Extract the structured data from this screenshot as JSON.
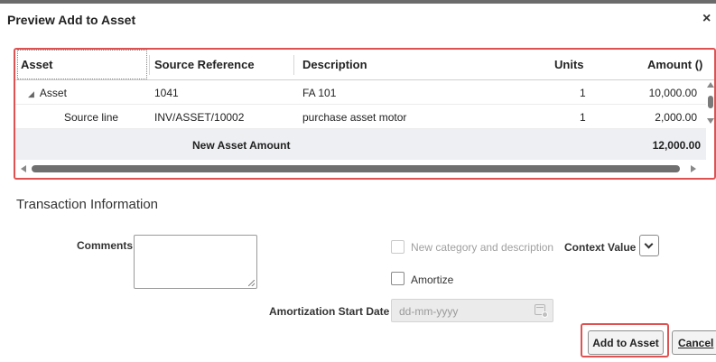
{
  "dialog": {
    "title": "Preview Add to Asset",
    "close_label": "×"
  },
  "table": {
    "columns": {
      "asset": "Asset",
      "source_reference": "Source Reference",
      "description": "Description",
      "units": "Units",
      "amount": "Amount ()"
    },
    "rows": [
      {
        "asset": "Asset",
        "source_reference": "1041",
        "description": "FA 101",
        "units": "1",
        "amount": "10,000.00"
      },
      {
        "asset": "Source line",
        "source_reference": "INV/ASSET/10002",
        "description": "purchase asset motor",
        "units": "1",
        "amount": "2,000.00"
      }
    ],
    "total": {
      "label": "New Asset Amount",
      "amount": "12,000.00"
    }
  },
  "transaction": {
    "section_title": "Transaction Information",
    "comments_label": "Comments",
    "comments_value": "",
    "new_category_label": "New category and description",
    "context_value_label": "Context Value",
    "amortize_label": "Amortize",
    "amortization_start_label": "Amortization Start Date",
    "amortization_start_placeholder": "dd-mm-yyyy"
  },
  "footer": {
    "add_to_asset_label": "Add to Asset",
    "cancel_label": "Cancel"
  },
  "colors": {
    "highlight": "#e05252",
    "total_row_bg": "#eeeff2"
  }
}
